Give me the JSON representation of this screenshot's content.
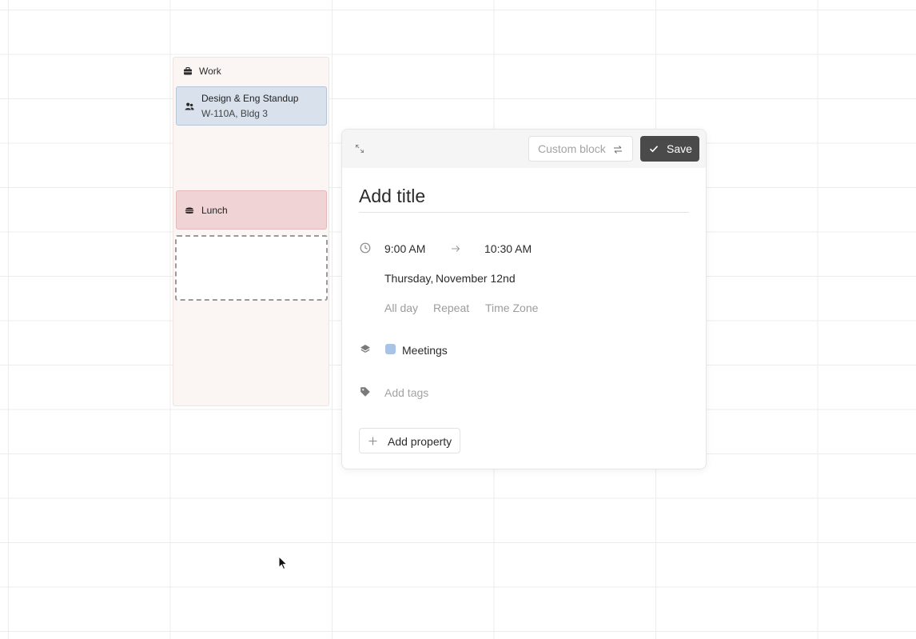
{
  "calendar": {
    "column": {
      "label": "Work",
      "icon": "briefcase-icon"
    },
    "events": [
      {
        "title": "Design & Eng Standup",
        "location": "W-110A, Bldg 3",
        "icon": "people-icon",
        "color": "#d8e1ec"
      },
      {
        "title": "Lunch",
        "icon": "burger-icon",
        "color": "#efd3d5"
      }
    ]
  },
  "popup": {
    "toolbar": {
      "expand_icon": "expand-icon",
      "block_type": "Custom block",
      "save_label": "Save"
    },
    "title_placeholder": "Add title",
    "time": {
      "start": "9:00 AM",
      "end": "10:30 AM",
      "weekday": "Thursday,",
      "date": "November 12nd"
    },
    "options": {
      "all_day": "All day",
      "repeat": "Repeat",
      "time_zone": "Time Zone"
    },
    "calendar_name": "Meetings",
    "calendar_color": "#a9c3e6",
    "tags_placeholder": "Add tags",
    "add_property_label": "Add property"
  },
  "colors": {
    "save_button": "#4a4a4a",
    "work_column_bg": "#fbf5f3"
  }
}
